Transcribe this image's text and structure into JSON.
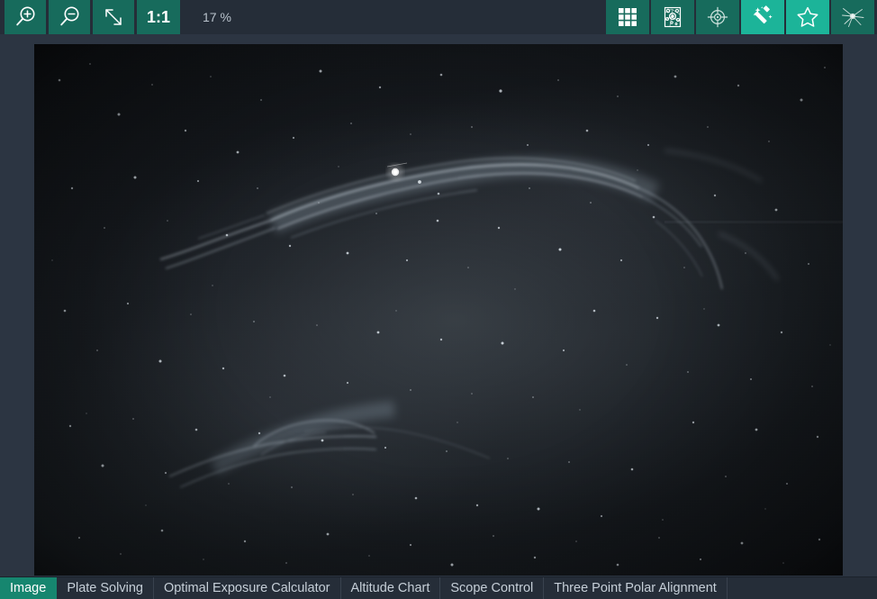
{
  "toolbar": {
    "zoom_in": {
      "label": "",
      "icon": "zoom-in-icon",
      "tooltip": "Zoom In"
    },
    "zoom_out": {
      "label": "",
      "icon": "zoom-out-icon",
      "tooltip": "Zoom Out"
    },
    "fit_to_screen": {
      "label": "",
      "icon": "fit-to-screen-icon",
      "tooltip": "Fit To Screen"
    },
    "one_to_one": {
      "label": "1:1",
      "icon": "one-to-one-icon",
      "tooltip": "Zoom 1:1"
    },
    "zoom_level": "17 %",
    "right_buttons": [
      {
        "name": "thumbnail-grid-button",
        "icon": "grid-icon",
        "active": false
      },
      {
        "name": "star-annotation-button",
        "icon": "star-annotation-map-icon",
        "active": false
      },
      {
        "name": "crosshair-button",
        "icon": "crosshair-icon",
        "active": false
      },
      {
        "name": "auto-stretch-button",
        "icon": "magic-wand-icon",
        "active": true
      },
      {
        "name": "star-detection-button",
        "icon": "star-outline-icon",
        "active": true
      },
      {
        "name": "bahtinov-focus-button",
        "icon": "star-diffraction-spikes-icon",
        "active": false
      }
    ]
  },
  "image": {
    "alt": "Western Veil Nebula NGC 6960 greyscale astrophotography frame",
    "zoom_percent": "17 %"
  },
  "tabs": [
    {
      "label": "Image",
      "active": true
    },
    {
      "label": "Plate Solving",
      "active": false
    },
    {
      "label": "Optimal Exposure Calculator",
      "active": false
    },
    {
      "label": "Altitude Chart",
      "active": false
    },
    {
      "label": "Scope Control",
      "active": false
    },
    {
      "label": "Three Point Polar Alignment",
      "active": false
    }
  ],
  "colors": {
    "accent": "#16866f",
    "accent_bright": "#1cb499",
    "toolbar_bg": "#252d38",
    "viewport_bg": "#2c3542",
    "text": "#c6cfd8",
    "text_muted": "#b9c2cc"
  }
}
